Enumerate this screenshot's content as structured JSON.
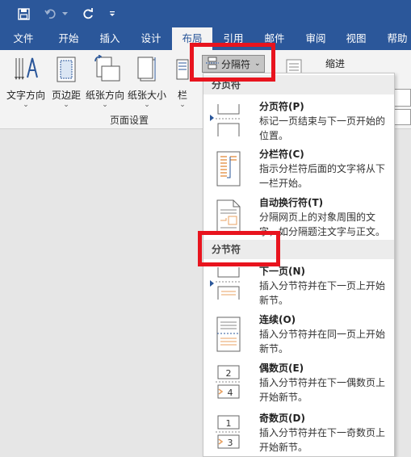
{
  "tabs": [
    {
      "label": "文件"
    },
    {
      "label": "开始"
    },
    {
      "label": "插入"
    },
    {
      "label": "设计"
    },
    {
      "label": "布局"
    },
    {
      "label": "引用"
    },
    {
      "label": "邮件"
    },
    {
      "label": "审阅"
    },
    {
      "label": "视图"
    },
    {
      "label": "帮助"
    }
  ],
  "active_tab": "布局",
  "ribbon": {
    "text_direction": "文字方向",
    "margins": "页边距",
    "orientation": "纸张方向",
    "size": "纸张大小",
    "columns": "栏",
    "group_label": "页面设置",
    "breaks": "分隔符",
    "indent": "缩进"
  },
  "menu": {
    "page_breaks_header": "分页符",
    "section_breaks_header": "分节符",
    "items": [
      {
        "title": "分页符(P)",
        "desc1": "标记一页结束与下一页开始的",
        "desc2": "位置。"
      },
      {
        "title": "分栏符(C)",
        "desc1": "指示分栏符后面的文字将从下",
        "desc2": "一栏开始。"
      },
      {
        "title": "自动换行符(T)",
        "desc1": "分隔网页上的对象周围的文",
        "desc2": "字，如分隔题注文字与正文。"
      },
      {
        "title": "下一页(N)",
        "desc1": "插入分节符并在下一页上开始",
        "desc2": "新节。"
      },
      {
        "title": "连续(O)",
        "desc1": "插入分节符并在同一页上开始",
        "desc2": "新节。"
      },
      {
        "title": "偶数页(E)",
        "desc1": "插入分节符并在下一偶数页上",
        "desc2": "开始新节。"
      },
      {
        "title": "奇数页(D)",
        "desc1": "插入分节符并在下一奇数页上",
        "desc2": "开始新节。"
      }
    ]
  },
  "colors": {
    "brand": "#2b579a",
    "highlight": "#e8141e"
  }
}
